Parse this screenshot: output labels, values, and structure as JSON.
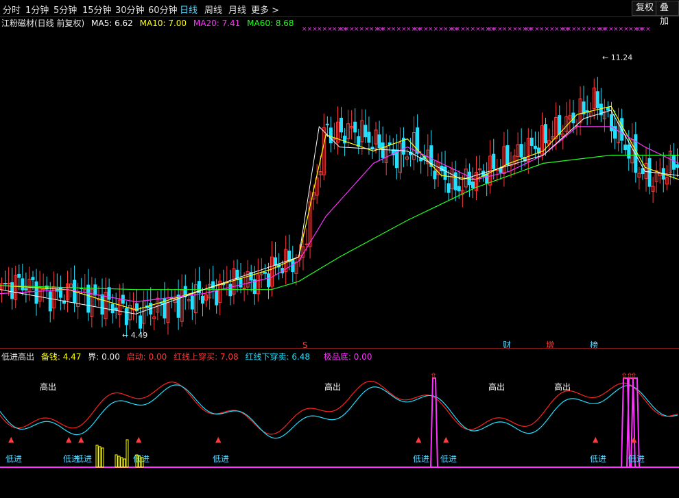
{
  "toolbar": {
    "timeframes": [
      "分时",
      "1分钟",
      "5分钟",
      "15分钟",
      "30分钟",
      "60分钟",
      "日线",
      "周线",
      "月线",
      "更多 >"
    ],
    "active": "日线",
    "buttons": [
      "复权",
      "叠加"
    ]
  },
  "main_legend": {
    "title": "江粉磁材(日线 前复权)",
    "ma5": "MA5: 6.62",
    "ma10": "MA10: 7.00",
    "ma20": "MA20: 7.41",
    "ma60": "MA60: 8.68"
  },
  "annotations": {
    "high": "11.24",
    "low": "4.49",
    "markers": [
      "S",
      "财",
      "增",
      "榜"
    ]
  },
  "indicator_legend": {
    "name": "低进高出",
    "beiqian": "备钱: 4.47",
    "jie": "界: 0.00",
    "qidong": "启动: 0.00",
    "red_up": "红线上穿买: 7.08",
    "red_down": "红线下穿卖: 6.48",
    "jipin": "极品底: 0.00"
  },
  "signals": {
    "buy": "低进",
    "sell": "高出"
  },
  "colors": {
    "up": "#ff3b3b",
    "down": "#22e0ff",
    "ma5": "#ffffff",
    "ma10": "#ffff00",
    "ma20": "#ff33ff",
    "ma60": "#22ff22",
    "accent": "#5ad7ff"
  },
  "chart_data": {
    "type": "candlestick",
    "title": "江粉磁材(日线 前复权)",
    "price_range_visible": [
      4.49,
      11.24
    ],
    "ma_current": {
      "MA5": 6.62,
      "MA10": 7.0,
      "MA20": 7.41,
      "MA60": 8.68
    },
    "ma_series": [
      {
        "name": "MA5",
        "x": [
          0,
          0.1,
          0.2,
          0.3,
          0.4,
          0.44,
          0.48,
          0.55,
          0.6,
          0.65,
          0.7,
          0.75,
          0.8,
          0.85,
          0.9,
          0.95,
          1.0
        ],
        "y": [
          5.6,
          5.5,
          5.0,
          5.5,
          6.0,
          6.3,
          9.3,
          8.9,
          9.2,
          8.3,
          8.2,
          8.6,
          8.9,
          9.8,
          10.0,
          8.5,
          8.2
        ]
      },
      {
        "name": "MA20",
        "x": [
          0,
          0.1,
          0.2,
          0.3,
          0.4,
          0.44,
          0.48,
          0.55,
          0.6,
          0.65,
          0.7,
          0.75,
          0.8,
          0.85,
          0.9,
          0.95,
          1.0
        ],
        "y": [
          5.4,
          5.5,
          5.2,
          5.4,
          5.8,
          6.2,
          7.3,
          8.6,
          9.0,
          8.6,
          8.2,
          8.4,
          8.8,
          9.5,
          9.5,
          9.0,
          8.6
        ]
      },
      {
        "name": "MA60",
        "x": [
          0,
          0.2,
          0.4,
          0.44,
          0.5,
          0.6,
          0.7,
          0.8,
          0.9,
          1.0
        ],
        "y": [
          5.6,
          5.5,
          5.5,
          5.7,
          6.3,
          7.2,
          8.0,
          8.6,
          8.8,
          8.8
        ]
      }
    ],
    "indicator": {
      "name": "低进高出",
      "values": {
        "备钱": 4.47,
        "界": 0.0,
        "启动": 0.0,
        "红线上穿买": 7.08,
        "红线下穿卖": 6.48,
        "极品底": 0.0
      },
      "signal_labels": [
        "低进",
        "高出"
      ]
    }
  }
}
